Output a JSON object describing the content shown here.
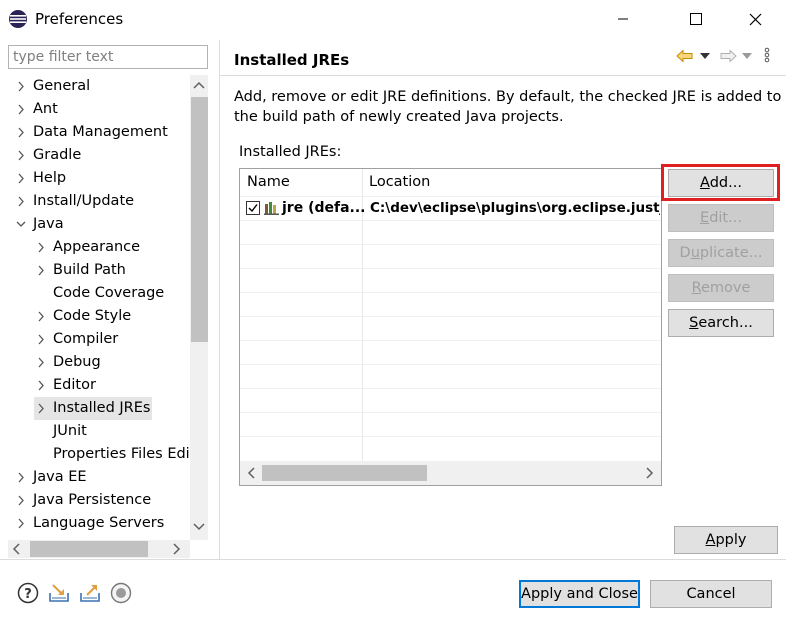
{
  "window": {
    "title": "Preferences"
  },
  "filter": {
    "placeholder": "type filter text"
  },
  "tree": [
    {
      "label": "General",
      "depth": 0,
      "expander": "collapsed"
    },
    {
      "label": "Ant",
      "depth": 0,
      "expander": "collapsed"
    },
    {
      "label": "Data Management",
      "depth": 0,
      "expander": "collapsed"
    },
    {
      "label": "Gradle",
      "depth": 0,
      "expander": "collapsed"
    },
    {
      "label": "Help",
      "depth": 0,
      "expander": "collapsed"
    },
    {
      "label": "Install/Update",
      "depth": 0,
      "expander": "collapsed"
    },
    {
      "label": "Java",
      "depth": 0,
      "expander": "expanded"
    },
    {
      "label": "Appearance",
      "depth": 1,
      "expander": "collapsed"
    },
    {
      "label": "Build Path",
      "depth": 1,
      "expander": "collapsed"
    },
    {
      "label": "Code Coverage",
      "depth": 1,
      "expander": "none"
    },
    {
      "label": "Code Style",
      "depth": 1,
      "expander": "collapsed"
    },
    {
      "label": "Compiler",
      "depth": 1,
      "expander": "collapsed"
    },
    {
      "label": "Debug",
      "depth": 1,
      "expander": "collapsed"
    },
    {
      "label": "Editor",
      "depth": 1,
      "expander": "collapsed"
    },
    {
      "label": "Installed JREs",
      "depth": 1,
      "expander": "collapsed",
      "selected": true
    },
    {
      "label": "JUnit",
      "depth": 1,
      "expander": "none"
    },
    {
      "label": "Properties Files Edito",
      "depth": 1,
      "expander": "none"
    },
    {
      "label": "Java EE",
      "depth": 0,
      "expander": "collapsed"
    },
    {
      "label": "Java Persistence",
      "depth": 0,
      "expander": "collapsed"
    },
    {
      "label": "Language Servers",
      "depth": 0,
      "expander": "collapsed"
    }
  ],
  "page": {
    "title": "Installed JREs",
    "description": "Add, remove or edit JRE definitions. By default, the checked JRE is added to the build path of newly created Java projects.",
    "table_label": "Installed JREs:",
    "columns": [
      "Name",
      "Location"
    ],
    "rows": [
      {
        "name": "jre (defa...",
        "location": "C:\\dev\\eclipse\\plugins\\org.eclipse.justj.",
        "checked": true
      }
    ]
  },
  "buttons": {
    "add": "Add...",
    "edit": "Edit...",
    "duplicate": "Duplicate...",
    "remove": "Remove",
    "search": "Search...",
    "apply": "Apply",
    "apply_close": "Apply and Close",
    "cancel": "Cancel"
  },
  "colors": {
    "highlight": "#e02020",
    "nav_back_arrow": "#e8a317"
  },
  "icons": [
    "help-icon",
    "import-icon",
    "export-icon",
    "record-icon"
  ]
}
